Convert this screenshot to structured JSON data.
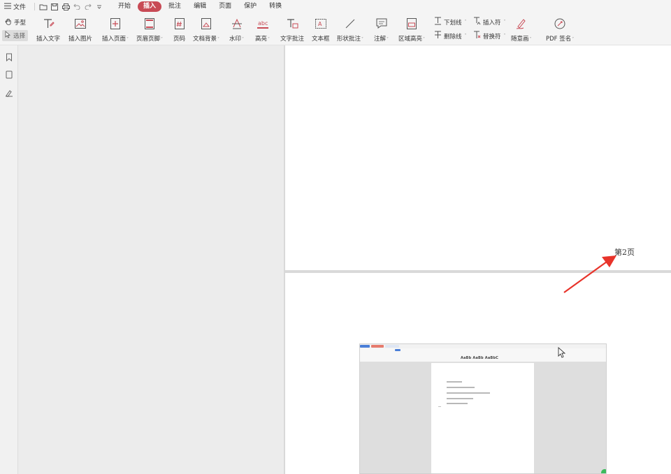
{
  "menubar": {
    "file_label": "文件",
    "menus": [
      "开始",
      "插入",
      "批注",
      "编辑",
      "页面",
      "保护",
      "转换"
    ],
    "active_menu": "插入"
  },
  "ribbon": {
    "hand_label": "手型",
    "select_label": "选择",
    "tools": [
      {
        "label": "插入文字",
        "icon": "insert-text-icon"
      },
      {
        "label": "插入图片",
        "icon": "insert-image-icon"
      },
      {
        "label": "插入页面",
        "icon": "insert-page-icon",
        "dropdown": true
      },
      {
        "label": "页眉页脚",
        "icon": "header-footer-icon",
        "dropdown": true
      },
      {
        "label": "页码",
        "icon": "page-number-icon"
      },
      {
        "label": "文档背景",
        "icon": "doc-background-icon",
        "dropdown": true
      },
      {
        "label": "水印",
        "icon": "watermark-icon",
        "dropdown": true
      },
      {
        "label": "高亮",
        "icon": "highlight-icon",
        "dropdown": true
      },
      {
        "label": "文字批注",
        "icon": "text-comment-icon"
      },
      {
        "label": "文本框",
        "icon": "textbox-icon"
      },
      {
        "label": "形状批注",
        "icon": "shape-comment-icon",
        "dropdown": true
      },
      {
        "label": "注解",
        "icon": "annotation-icon",
        "dropdown": true
      },
      {
        "label": "区域高亮",
        "icon": "area-highlight-icon",
        "dropdown": true
      }
    ],
    "text_tools": {
      "underline": "下划线",
      "strikethrough": "删除线",
      "insert_caret": "插入符",
      "replace_caret": "替换符",
      "freehand": "随意画",
      "pdf_sign": "PDF 签名"
    }
  },
  "document": {
    "page_label": "第2页",
    "embedded_heading": "AaBb AaBb AaBbC"
  },
  "colors": {
    "accent": "#c84a55",
    "arrow": "#e8332a"
  }
}
